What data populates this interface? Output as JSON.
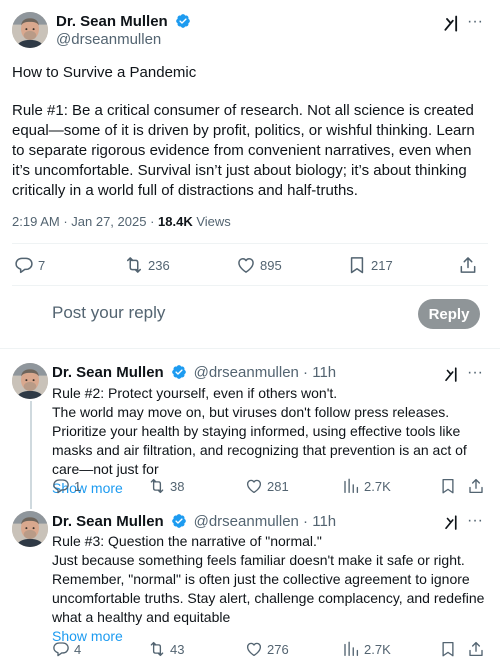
{
  "main_tweet": {
    "author_name": "Dr. Sean Mullen",
    "handle": "@drseanmullen",
    "title": "How to Survive a Pandemic",
    "body": "Rule #1: Be a critical consumer of research. Not all science is created equal—some of it is driven by profit, politics, or wishful thinking. Learn to separate rigorous evidence from convenient narratives, even when it’s uncomfortable. Survival isn’t just about biology; it’s about thinking critically in a world full of distractions and half-truths.",
    "time": "2:19 AM",
    "date": "Jan 27, 2025",
    "separator": " · ",
    "views_count": "18.4K",
    "views_label": " Views",
    "replies": "7",
    "reposts": "236",
    "likes": "895",
    "bookmarks": "217"
  },
  "reply_box": {
    "placeholder": "Post your reply",
    "button_label": "Reply"
  },
  "replies": [
    {
      "author_name": "Dr. Sean Mullen",
      "handle": "@drseanmullen",
      "age": " · 11h",
      "line1": "Rule #2: Protect yourself, even if others won't.",
      "body": "The world may move on, but viruses don't follow press releases. Prioritize your health by staying informed, using effective tools like masks and air filtration, and recognizing that prevention is an act of care—not just for",
      "show_more": "Show more",
      "replies": "1",
      "reposts": "38",
      "likes": "281",
      "views": "2.7K"
    },
    {
      "author_name": "Dr. Sean Mullen",
      "handle": "@drseanmullen",
      "age": " · 11h",
      "line1": "Rule #3: Question the narrative of \"normal.\"",
      "body": "Just because something feels familiar doesn't make it safe or right. Remember, \"normal\" is often just the collective agreement to ignore uncomfortable truths. Stay alert, challenge complacency, and redefine what a healthy and equitable",
      "show_more": "Show more",
      "replies": "4",
      "reposts": "43",
      "likes": "276",
      "views": "2.7K"
    }
  ],
  "colors": {
    "link": "#1d9bf0",
    "text": "#0f1419",
    "muted": "#536471",
    "reply_button": "#8f9598",
    "verified": "#1d9bf0"
  },
  "icons": [
    "verified-badge-icon",
    "grok-icon",
    "more-icon",
    "reply-icon",
    "repost-icon",
    "like-icon",
    "bookmark-icon",
    "share-icon",
    "views-icon"
  ]
}
